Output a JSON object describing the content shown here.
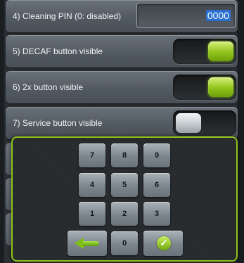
{
  "settings": {
    "rows": [
      {
        "label": "4) Cleaning PIN (0: disabled)",
        "value": "0000"
      },
      {
        "label": "5) DECAF button visible",
        "state": "on"
      },
      {
        "label": "6) 2x button visible",
        "state": "on"
      },
      {
        "label": "7) Service button visible",
        "state": "off"
      }
    ]
  },
  "keypad": {
    "keys": [
      "7",
      "8",
      "9",
      "4",
      "5",
      "6",
      "1",
      "2",
      "3",
      "0"
    ],
    "backspace_icon": "left-arrow-icon",
    "confirm_icon": "checkmark-icon",
    "confirm_glyph": "✓"
  },
  "colors": {
    "accent_green": "#8fc31a",
    "selection_blue": "#2a6fd0",
    "row_gray": "#5a6269"
  }
}
